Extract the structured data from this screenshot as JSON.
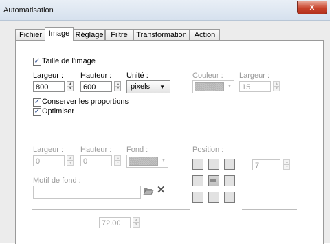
{
  "window": {
    "title": "Automatisation",
    "close_glyph": "x"
  },
  "tabs": [
    "Fichier",
    "Image",
    "Réglage",
    "Filtre",
    "Transformation",
    "Action"
  ],
  "image_size": {
    "checkbox_label": "Taille de l'image",
    "checked": true,
    "width_label": "Largeur :",
    "width_value": "800",
    "height_label": "Hauteur :",
    "height_value": "600",
    "unit_label": "Unité :",
    "unit_value": "pixels",
    "color_label": "Couleur :",
    "border_width_label": "Largeur :",
    "border_width_value": "15"
  },
  "options": {
    "keep_proportions": "Conserver les proportions",
    "optimize": "Optimiser"
  },
  "canvas": {
    "width_label": "Largeur :",
    "width_value": "0",
    "height_label": "Hauteur :",
    "height_value": "0",
    "background_label": "Fond :",
    "position_label": "Position :",
    "position_value": "7",
    "pattern_label": "Motif de fond :"
  },
  "resolution_value": "72.00",
  "icons": {
    "open_folder": "folder-open-icon",
    "clear": "close-icon"
  }
}
